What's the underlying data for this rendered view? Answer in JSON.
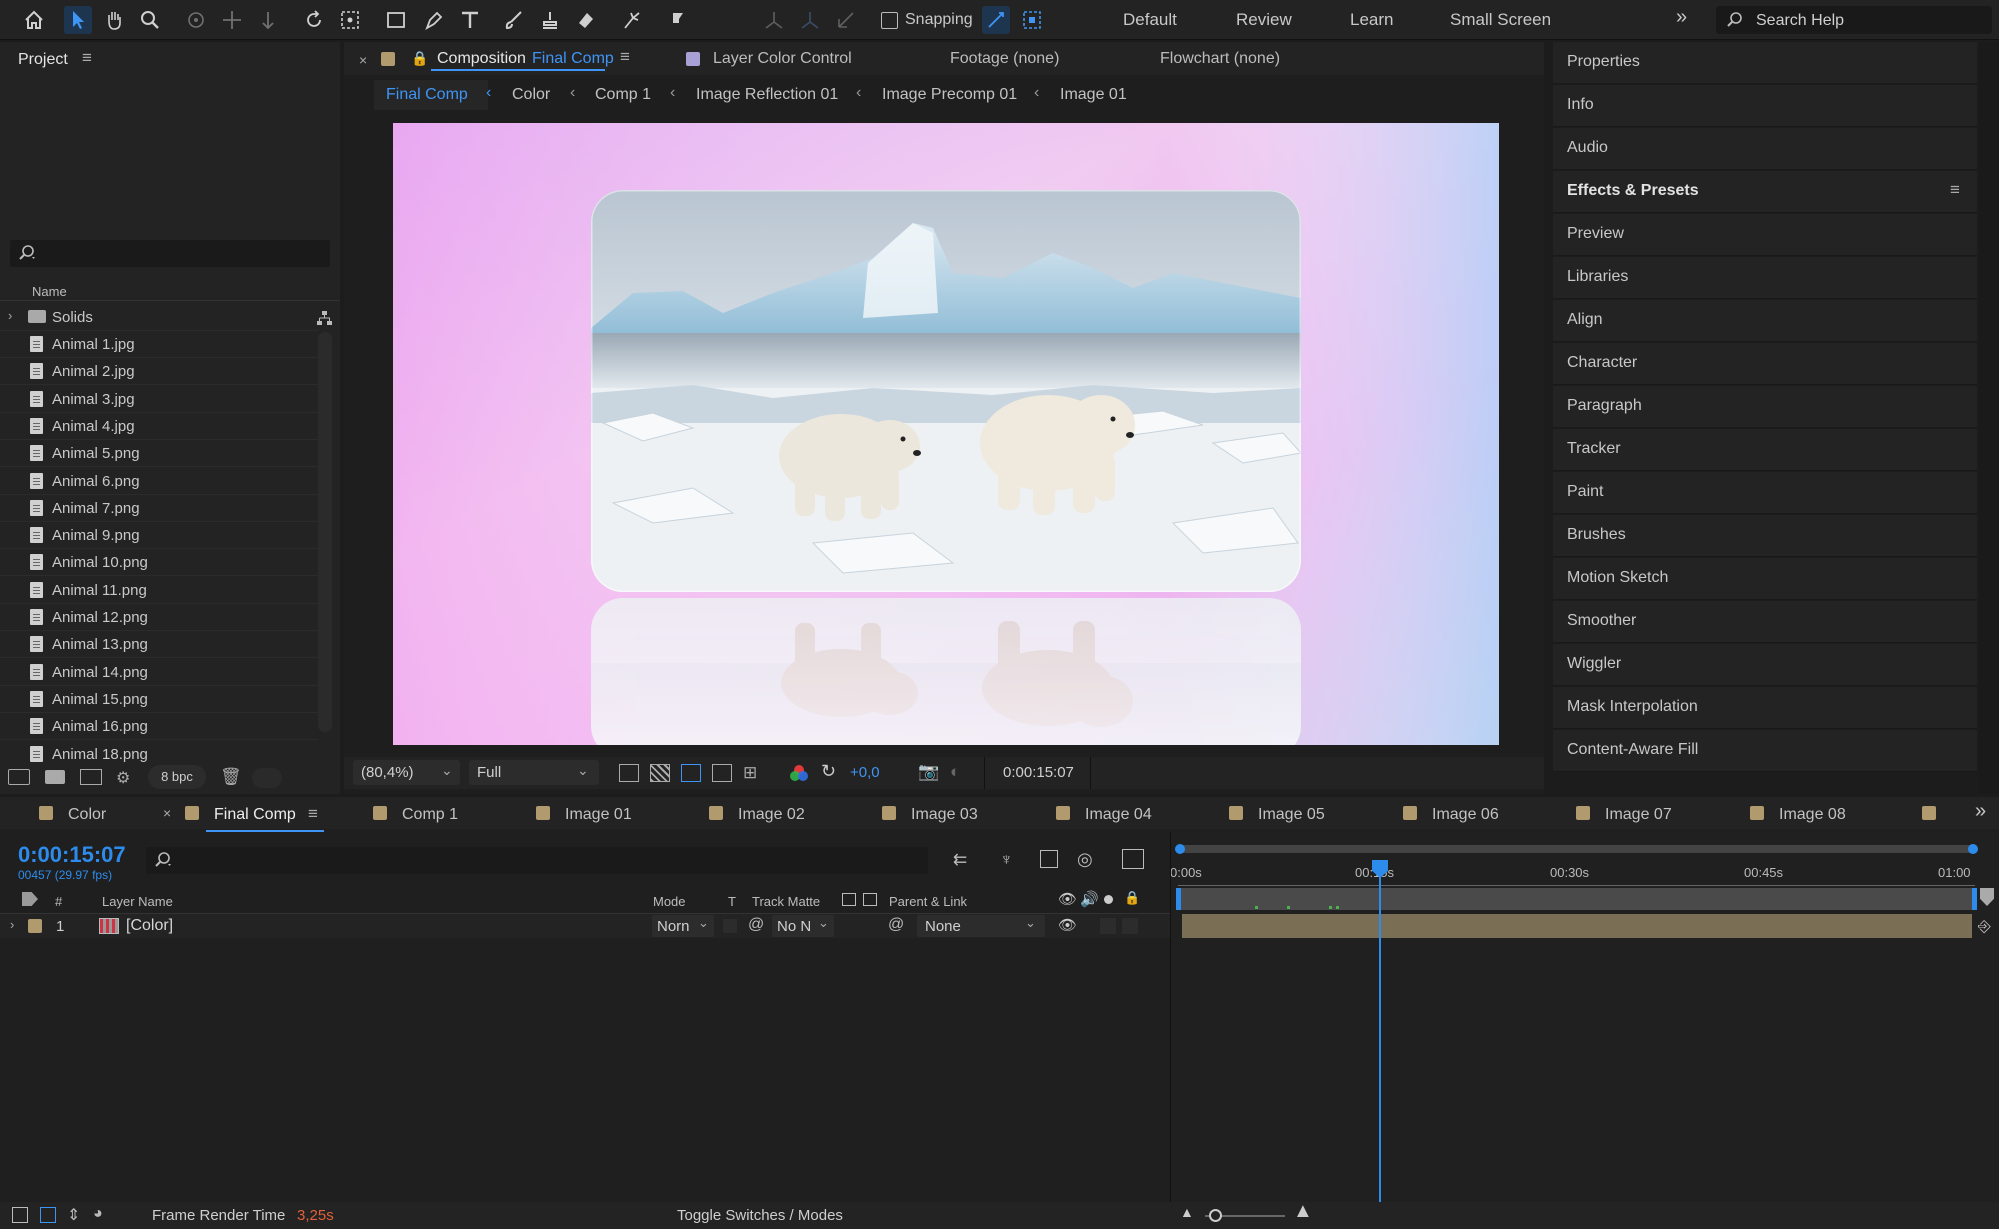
{
  "toolbar": {
    "snapping_label": "Snapping",
    "workspaces": [
      "Default",
      "Review",
      "Learn",
      "Small Screen"
    ],
    "search_placeholder": "Search Help"
  },
  "project": {
    "title": "Project",
    "column_name": "Name",
    "folder": "Solids",
    "items": [
      "Animal 1.jpg",
      "Animal 2.jpg",
      "Animal 3.jpg",
      "Animal 4.jpg",
      "Animal 5.png",
      "Animal 6.png",
      "Animal 7.png",
      "Animal 9.png",
      "Animal 10.png",
      "Animal 11.png",
      "Animal 12.png",
      "Animal 13.png",
      "Animal 14.png",
      "Animal 15.png",
      "Animal 16.png",
      "Animal 18.png"
    ],
    "bpc": "8 bpc"
  },
  "composition": {
    "tab_prefix": "Composition",
    "tab_name": "Final Comp",
    "other_tabs": [
      "Layer Color Control",
      "Footage (none)",
      "Flowchart (none)"
    ],
    "breadcrumbs": [
      "Final Comp",
      "Color",
      "Comp 1",
      "Image Reflection 01",
      "Image Precomp 01",
      "Image 01"
    ],
    "zoom": "(80,4%)",
    "resolution": "Full",
    "exposure": "+0,0",
    "timecode": "0:00:15:07"
  },
  "right_panel": {
    "items": [
      "Properties",
      "Info",
      "Audio",
      "Effects & Presets",
      "Preview",
      "Libraries",
      "Align",
      "Character",
      "Paragraph",
      "Tracker",
      "Paint",
      "Brushes",
      "Motion Sketch",
      "Smoother",
      "Wiggler",
      "Mask Interpolation",
      "Content-Aware Fill"
    ]
  },
  "timeline": {
    "tabs": [
      "Color",
      "Final Comp",
      "Comp 1",
      "Image 01",
      "Image 02",
      "Image 03",
      "Image 04",
      "Image 05",
      "Image 06",
      "Image 07",
      "Image 08"
    ],
    "current_time": "0:00:15:07",
    "frame_info": "00457 (29.97 fps)",
    "columns": {
      "num": "#",
      "layer_name": "Layer Name",
      "mode": "Mode",
      "t": "T",
      "track_matte": "Track Matte",
      "parent": "Parent & Link"
    },
    "layer": {
      "index": "1",
      "name": "[Color]",
      "mode": "Norn",
      "matte": "No N",
      "parent": "None"
    },
    "ruler": [
      "0:00s",
      "00:15s",
      "00:30s",
      "00:45s",
      "01:00"
    ],
    "render_label": "Frame Render Time",
    "render_value": "3,25s",
    "toggle_label": "Toggle Switches / Modes"
  },
  "colors": {
    "accent": "#2d8ceb",
    "label": "#b19a6e",
    "render": "#e0603a"
  }
}
